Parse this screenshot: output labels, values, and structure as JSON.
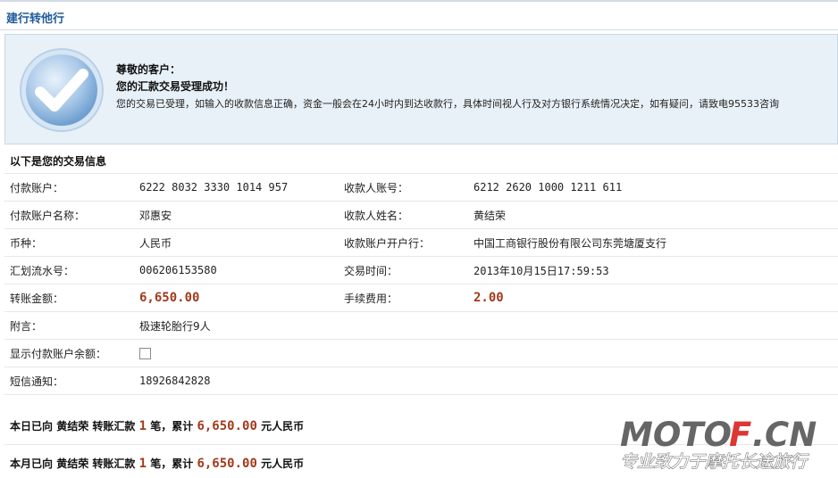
{
  "header": {
    "title": "建行转他行"
  },
  "success": {
    "greeting": "尊敬的客户：",
    "headline": "您的汇款交易受理成功！",
    "detail": "您的交易已受理，如输入的收款信息正确，资金一般会在24小时内到达收款行，具体时间视人行及对方银行系统情况决定，如有疑问，请致电95533咨询"
  },
  "section_title": "以下是您的交易信息",
  "info": {
    "payer_account_label": "付款账户：",
    "payer_account": "6222 8032 3330 1014 957",
    "payee_account_label": "收款人账号：",
    "payee_account": "6212 2620 1000 1211 611",
    "payer_name_label": "付款账户名称：",
    "payer_name": "邓惠安",
    "payee_name_label": "收款人姓名：",
    "payee_name": "黄结荣",
    "currency_label": "币种：",
    "currency": "人民币",
    "payee_bank_label": "收款账户开户行：",
    "payee_bank": "中国工商银行股份有限公司东莞塘厦支行",
    "serial_label": "汇划流水号：",
    "serial": "006206153580",
    "time_label": "交易时间：",
    "time": "2013年10月15日17:59:53",
    "amount_label": "转账金额：",
    "amount": "6,650.00",
    "fee_label": "手续费用：",
    "fee": "2.00",
    "note_label": "附言：",
    "note": "极速轮胎行9人",
    "show_balance_label": "显示付款账户余额：",
    "show_balance_checked": false,
    "sms_label": "短信通知：",
    "sms": "18926842828"
  },
  "summary_day": {
    "prefix": "本日已向",
    "name": "黄结荣",
    "mid": "转账汇款",
    "count": "1",
    "unit": "笔，累计",
    "total": "6,650.00",
    "suffix": "元人民币"
  },
  "summary_month": {
    "prefix": "本月已向",
    "name": "黄结荣",
    "mid": "转账汇款",
    "count": "1",
    "unit": "笔，累计",
    "total": "6,650.00",
    "suffix": "元人民币"
  },
  "watermark": {
    "logo": "MOTOF.CN",
    "slogan": "专业致力于摩托长途旅行"
  },
  "colors": {
    "accent_blue": "#1f5b99",
    "amount_red": "#a23a1c",
    "panel_bg": "#e8f1f8",
    "watermark_red": "#d9211d"
  }
}
